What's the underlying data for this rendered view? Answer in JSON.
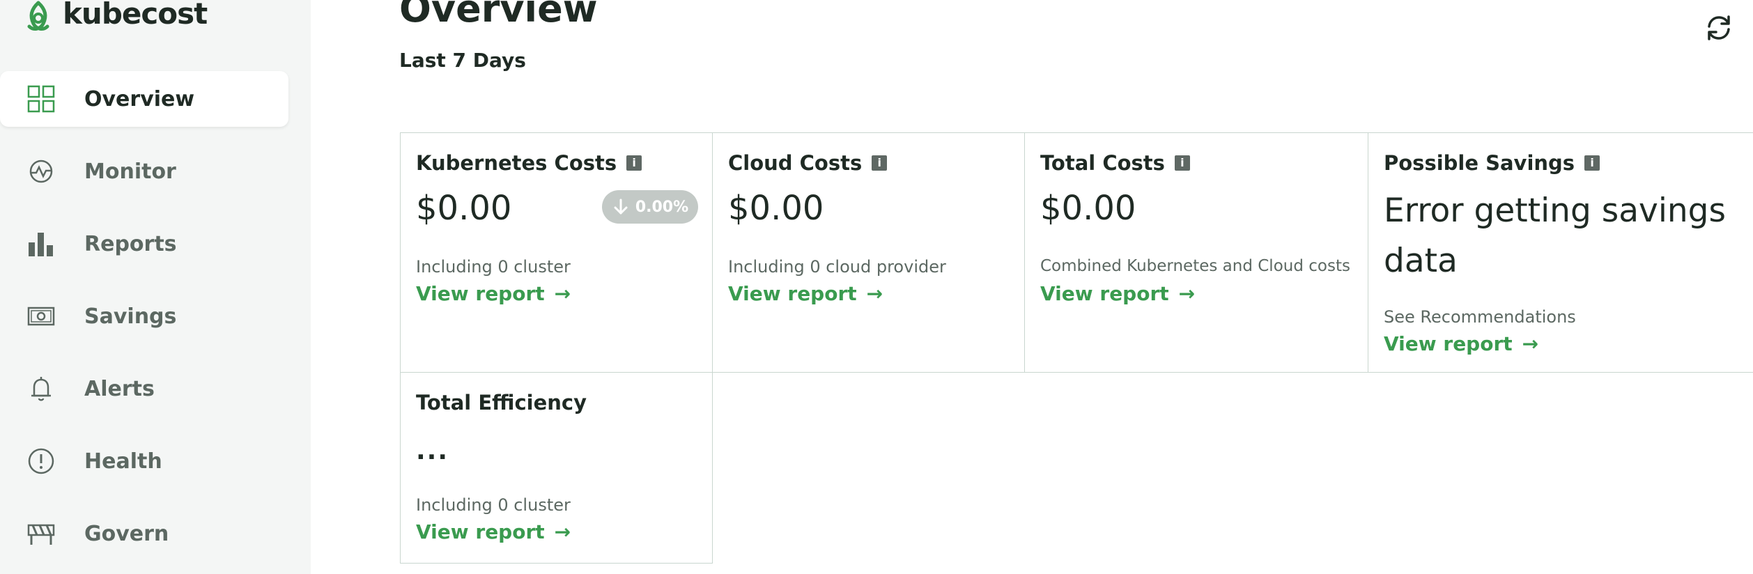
{
  "brand": {
    "name": "kubecost",
    "color": "#3a9b4f"
  },
  "sidebar": {
    "items": [
      {
        "label": "Overview",
        "icon": "grid-icon",
        "active": true
      },
      {
        "label": "Monitor",
        "icon": "monitor-icon"
      },
      {
        "label": "Reports",
        "icon": "bar-chart-icon"
      },
      {
        "label": "Savings",
        "icon": "money-icon"
      },
      {
        "label": "Alerts",
        "icon": "bell-icon"
      },
      {
        "label": "Health",
        "icon": "exclamation-circle-icon"
      },
      {
        "label": "Govern",
        "icon": "barrier-icon"
      }
    ]
  },
  "header": {
    "title": "Overview",
    "subtitle": "Last 7 Days",
    "refresh_icon": "refresh-icon"
  },
  "cards": {
    "kubernetes": {
      "title": "Kubernetes Costs",
      "value": "$0.00",
      "badge": "0.00%",
      "note": "Including 0 cluster",
      "link": "View report"
    },
    "cloud": {
      "title": "Cloud Costs",
      "value": "$0.00",
      "note": "Including 0 cloud provider",
      "link": "View report"
    },
    "total": {
      "title": "Total Costs",
      "value": "$0.00",
      "note": "Combined Kubernetes and Cloud costs",
      "link": "View report"
    },
    "savings": {
      "title": "Possible Savings",
      "error": "Error getting savings data",
      "note": "See Recommendations",
      "link": "View report"
    },
    "efficiency": {
      "title": "Total Efficiency",
      "value": "...",
      "note": "Including 0 cluster",
      "link": "View report"
    }
  },
  "arrow": "→",
  "info_glyph": "i"
}
